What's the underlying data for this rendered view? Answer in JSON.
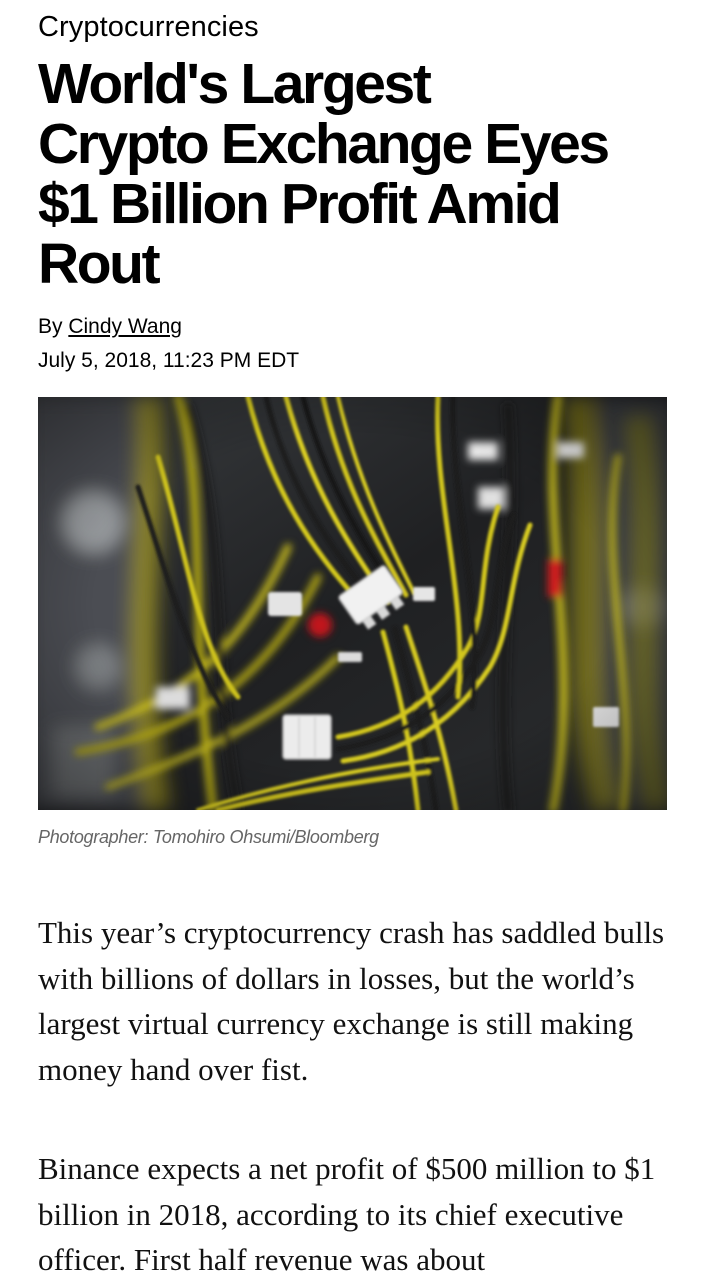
{
  "article": {
    "section": "Cryptocurrencies",
    "headline_lines": [
      "World's Largest",
      "Crypto Exchange Eyes",
      "$1 Billion Profit Amid",
      "Rout"
    ],
    "byline_prefix": "By ",
    "author": "Cindy Wang",
    "date": "July 5, 2018, 11:23 PM EDT",
    "photo": {
      "description_icon": "photo-image",
      "caption": "Photographer: Tomohiro Ohsumi/Bloomberg"
    },
    "paragraphs": [
      "This year’s cryptocurrency crash has saddled bulls with billions of dollars in losses, but the world’s largest virtual currency exchange is still making money hand over fist.",
      "Binance expects a net profit of $500 million to $1 billion in 2018, according to its chief executive officer. First half revenue was about"
    ]
  },
  "colors": {
    "text": "#000000",
    "caption": "#666666",
    "cable_yellow": "#d8cc1c",
    "background": "#ffffff"
  }
}
